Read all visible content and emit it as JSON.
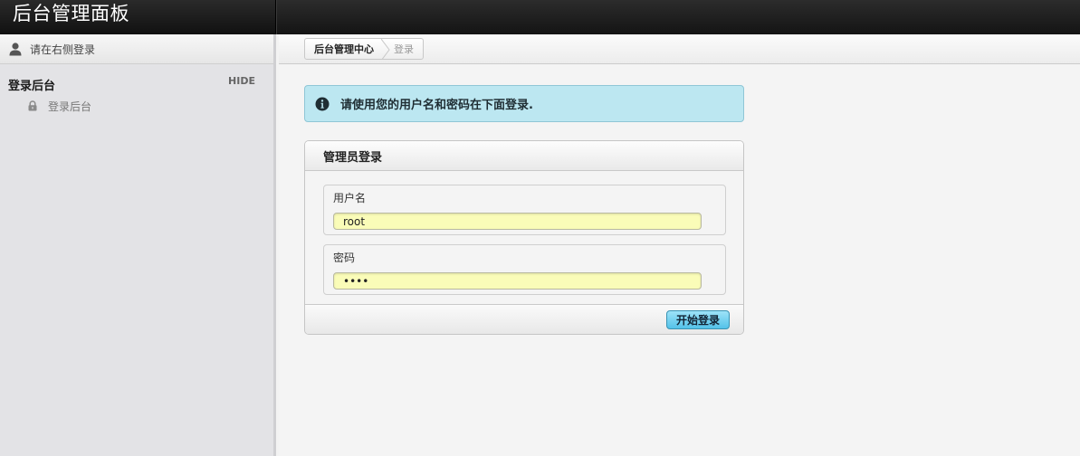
{
  "header": {
    "title": "后台管理面板"
  },
  "sidebar": {
    "user_text": "请在右侧登录",
    "section_title": "登录后台",
    "hide_label": "HIDE",
    "items": [
      {
        "label": "登录后台",
        "icon": "lock-icon"
      }
    ]
  },
  "breadcrumb": {
    "home": "后台管理中心",
    "current": "登录"
  },
  "info": {
    "message": "请使用您的用户名和密码在下面登录.",
    "icon": "info-icon"
  },
  "login": {
    "title": "管理员登录",
    "username_label": "用户名",
    "username_value": "root",
    "password_label": "密码",
    "password_value": "••••",
    "submit_label": "开始登录"
  },
  "colors": {
    "header_bg": "#1a1a1a",
    "info_bg": "#bce7f1",
    "input_bg": "#fafcb8",
    "button_bg": "#53c2e9"
  }
}
